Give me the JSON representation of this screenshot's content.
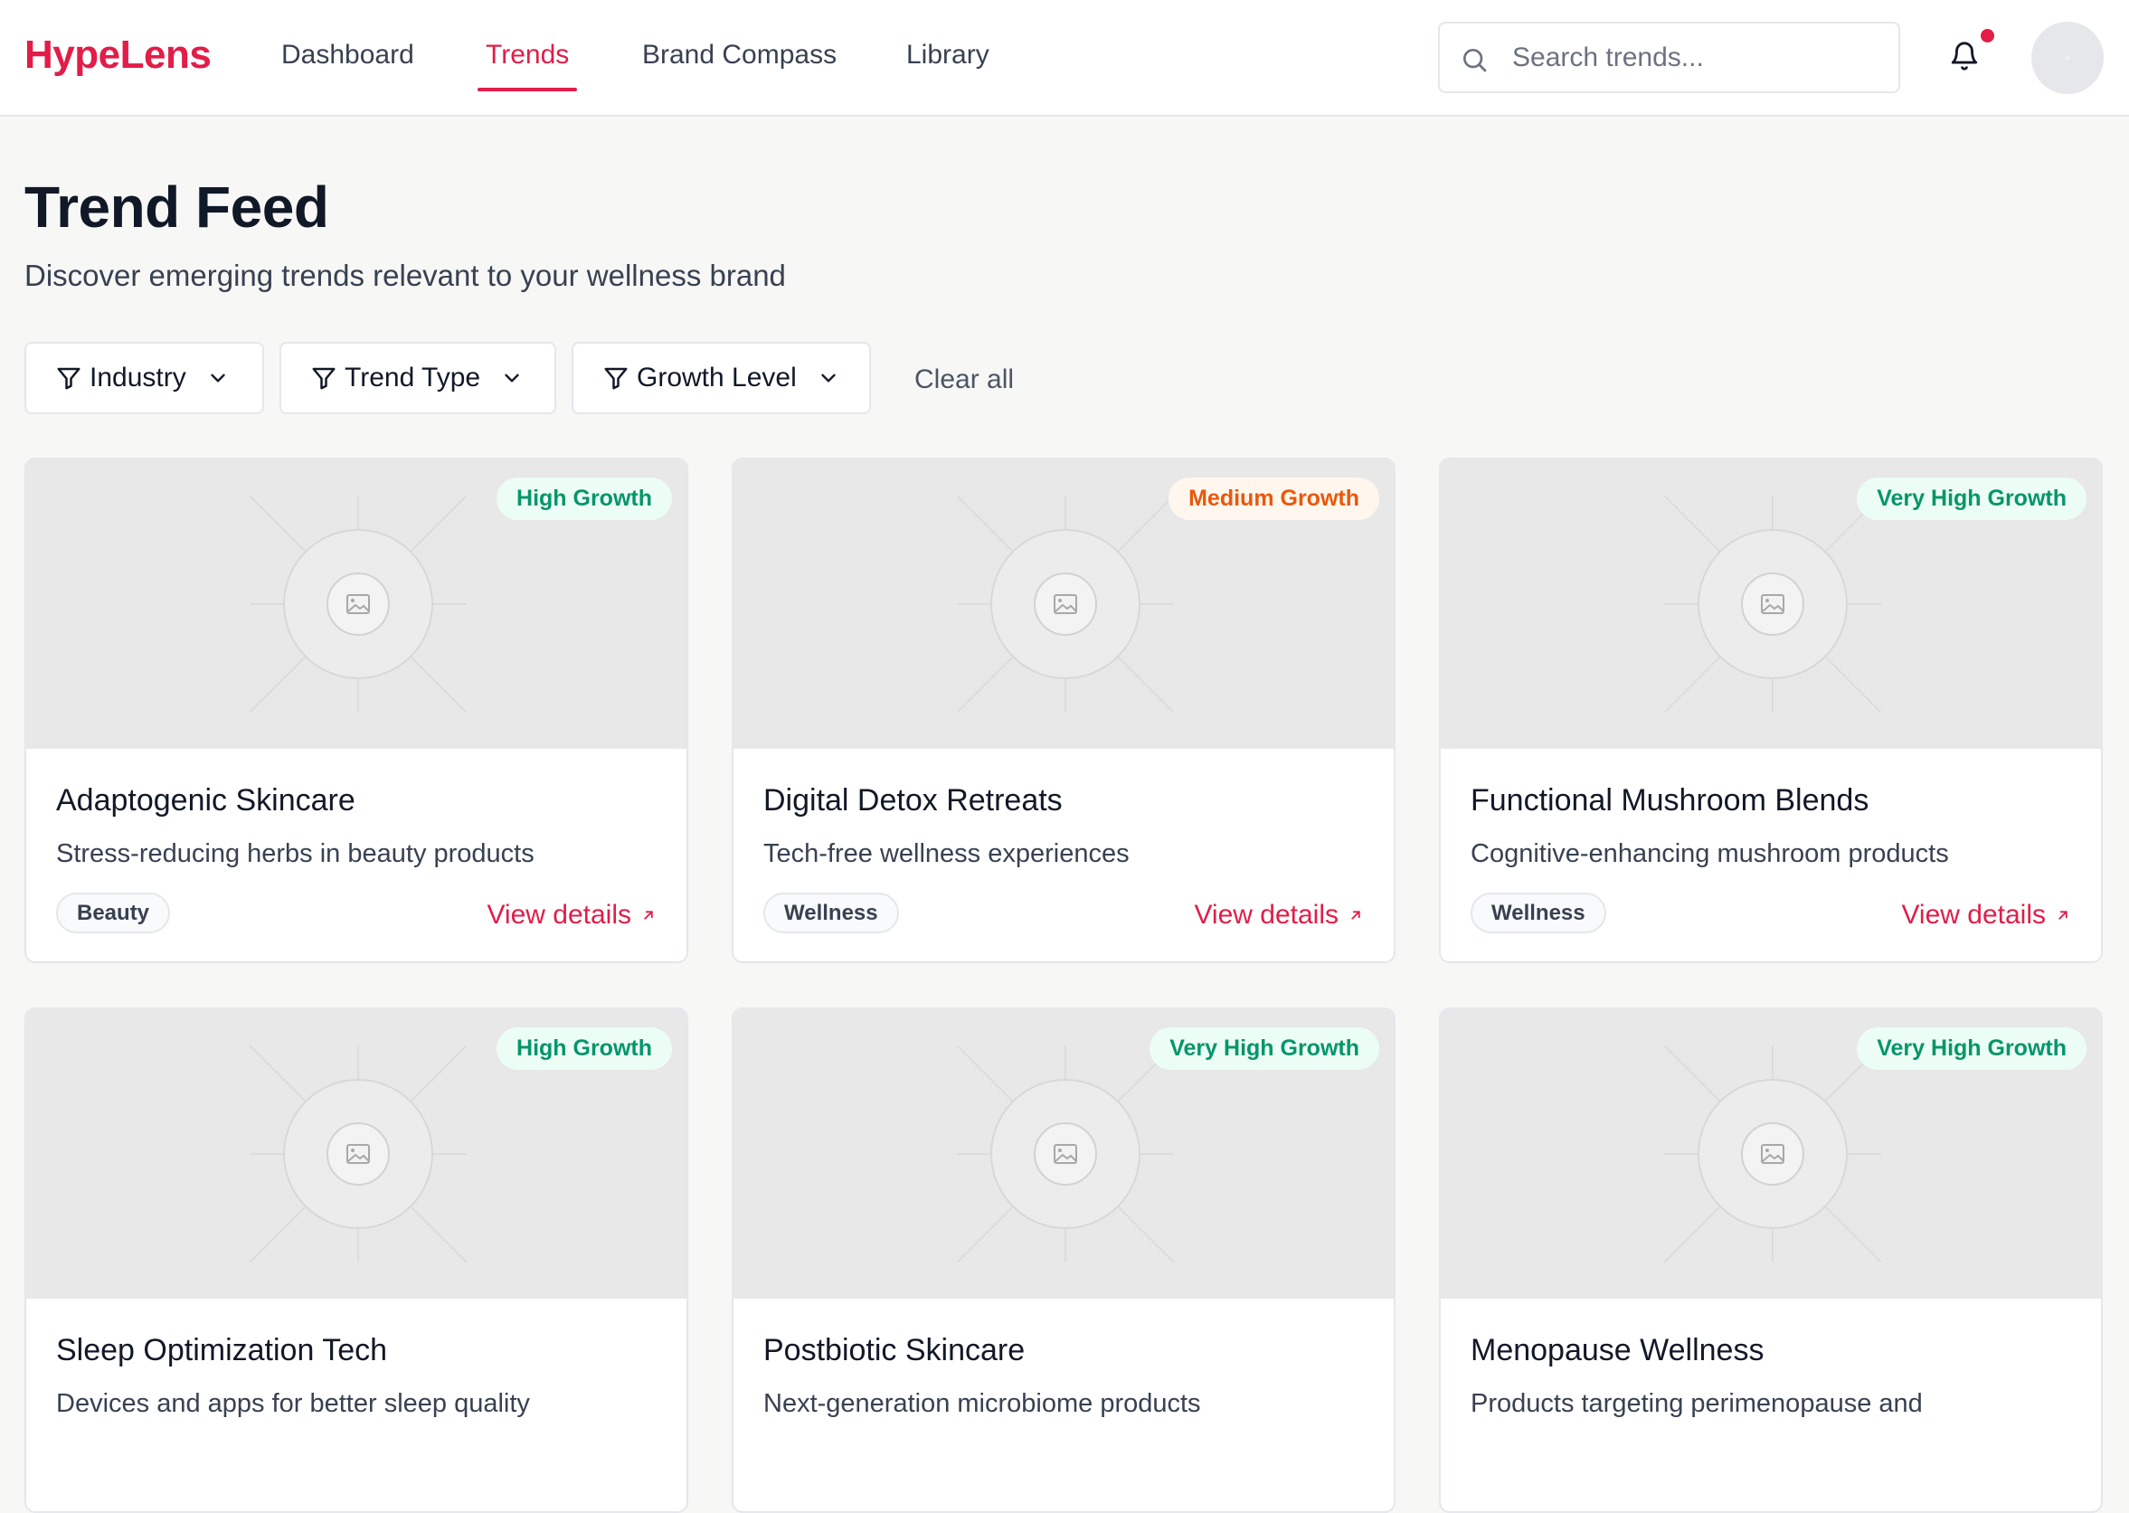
{
  "app": {
    "logo": "HypeLens",
    "nav": [
      {
        "label": "Dashboard",
        "active": false
      },
      {
        "label": "Trends",
        "active": true
      },
      {
        "label": "Brand Compass",
        "active": false
      },
      {
        "label": "Library",
        "active": false
      }
    ],
    "search": {
      "placeholder": "Search trends...",
      "value": ""
    },
    "notifications": {
      "icon": "bell-icon",
      "has_unread": true
    },
    "colors": {
      "accent": "#e11d48",
      "high_growth": "#059669",
      "medium_growth": "#ea580c"
    }
  },
  "page": {
    "title": "Trend Feed",
    "subtitle": "Discover emerging trends relevant to your wellness brand"
  },
  "filters": {
    "items": [
      {
        "label": "Industry",
        "icon": "filter-icon"
      },
      {
        "label": "Trend Type",
        "icon": "filter-icon"
      },
      {
        "label": "Growth Level",
        "icon": "filter-icon"
      }
    ],
    "clear_label": "Clear all"
  },
  "trends": [
    {
      "title": "Adaptogenic Skincare",
      "description": "Stress-reducing herbs in beauty products",
      "tag": "Beauty",
      "growth": "High Growth",
      "growth_level": "high",
      "link": "View details"
    },
    {
      "title": "Digital Detox Retreats",
      "description": "Tech-free wellness experiences",
      "tag": "Wellness",
      "growth": "Medium Growth",
      "growth_level": "medium",
      "link": "View details"
    },
    {
      "title": "Functional Mushroom Blends",
      "description": "Cognitive-enhancing mushroom products",
      "tag": "Wellness",
      "growth": "Very High Growth",
      "growth_level": "high",
      "link": "View details"
    },
    {
      "title": "Sleep Optimization Tech",
      "description": "Devices and apps for better sleep quality",
      "tag": "",
      "growth": "High Growth",
      "growth_level": "high",
      "link": ""
    },
    {
      "title": "Postbiotic Skincare",
      "description": "Next-generation microbiome products",
      "tag": "",
      "growth": "Very High Growth",
      "growth_level": "high",
      "link": ""
    },
    {
      "title": "Menopause Wellness",
      "description": "Products targeting perimenopause and",
      "tag": "",
      "growth": "Very High Growth",
      "growth_level": "high",
      "link": ""
    }
  ]
}
